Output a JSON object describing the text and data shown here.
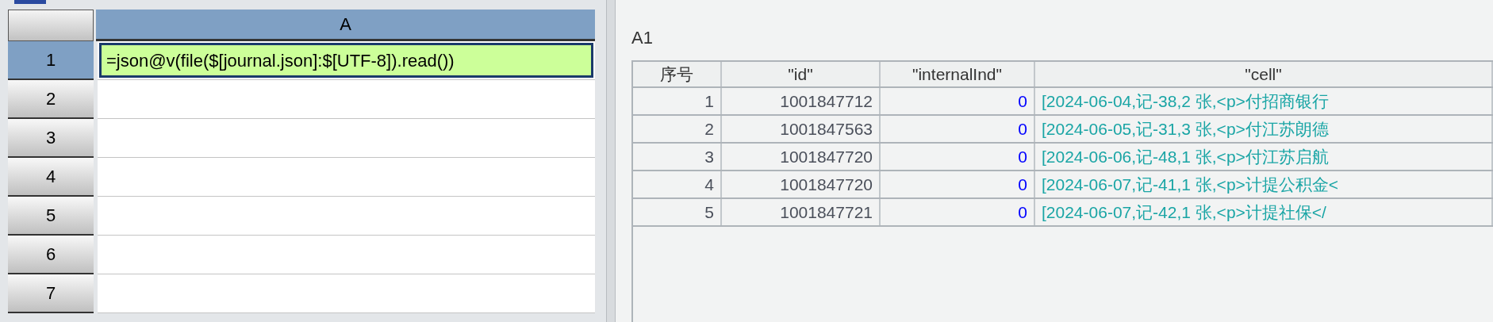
{
  "sheet": {
    "columns": [
      {
        "label": "A",
        "selected": true
      }
    ],
    "rows": [
      {
        "label": "1",
        "selected": true,
        "value": "=json@v(file($[journal.json]:$[UTF-8]).read())"
      },
      {
        "label": "2",
        "selected": false,
        "value": ""
      },
      {
        "label": "3",
        "selected": false,
        "value": ""
      },
      {
        "label": "4",
        "selected": false,
        "value": ""
      },
      {
        "label": "5",
        "selected": false,
        "value": ""
      },
      {
        "label": "6",
        "selected": false,
        "value": ""
      },
      {
        "label": "7",
        "selected": false,
        "value": ""
      }
    ]
  },
  "result": {
    "cell_name": "A1",
    "columns": [
      "序号",
      "\"id\"",
      "\"internalInd\"",
      "\"cell\""
    ],
    "rows": [
      [
        "1",
        "1001847712",
        "0",
        "[2024-06-04,记-38,2 张,<p>付招商银行"
      ],
      [
        "2",
        "1001847563",
        "0",
        "[2024-06-05,记-31,3 张,<p>付江苏朗德"
      ],
      [
        "3",
        "1001847720",
        "0",
        "[2024-06-06,记-48,1 张,<p>付江苏启航"
      ],
      [
        "4",
        "1001847720",
        "0",
        "[2024-06-07,记-41,1 张,<p>计提公积金<"
      ],
      [
        "5",
        "1001847721",
        "0",
        "[2024-06-07,记-42,1 张,<p>计提社保</"
      ]
    ]
  }
}
